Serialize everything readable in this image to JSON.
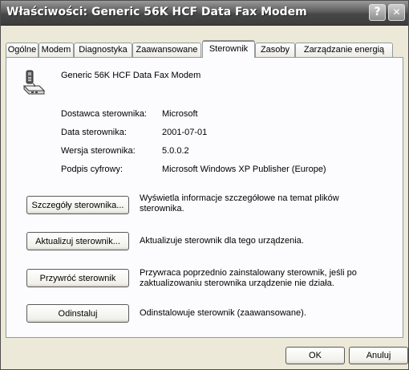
{
  "window": {
    "title": "Właściwości: Generic 56K HCF Data Fax Modem",
    "help_button": "?",
    "close_button": "✕"
  },
  "tabs": [
    {
      "label": "Ogólne"
    },
    {
      "label": "Modem"
    },
    {
      "label": "Diagnostyka"
    },
    {
      "label": "Zaawansowane"
    },
    {
      "label": "Sterownik"
    },
    {
      "label": "Zasoby"
    },
    {
      "label": "Zarządzanie energią"
    }
  ],
  "active_tab": "Sterownik",
  "device": {
    "name": "Generic 56K HCF Data Fax Modem",
    "icon": "modem-icon"
  },
  "driver_info": [
    {
      "label": "Dostawca sterownika:",
      "value": "Microsoft"
    },
    {
      "label": "Data sterownika:",
      "value": "2001-07-01"
    },
    {
      "label": "Wersja sterownika:",
      "value": "5.0.0.2"
    },
    {
      "label": "Podpis cyfrowy:",
      "value": "Microsoft Windows XP Publisher (Europe)"
    }
  ],
  "actions": [
    {
      "button": "Szczegóły sterownika...",
      "description": "Wyświetla informacje szczegółowe na temat plików sterownika."
    },
    {
      "button": "Aktualizuj sterownik...",
      "description": "Aktualizuje sterownik dla tego urządzenia."
    },
    {
      "button": "Przywróć sterownik",
      "description": "Przywraca poprzednio zainstalowany sterownik, jeśli po zaktualizowaniu sterownika urządzenie nie działa."
    },
    {
      "button": "Odinstaluj",
      "description": "Odinstalowuje sterownik (zaawansowane)."
    }
  ],
  "footer": {
    "ok": "OK",
    "cancel": "Anuluj"
  }
}
